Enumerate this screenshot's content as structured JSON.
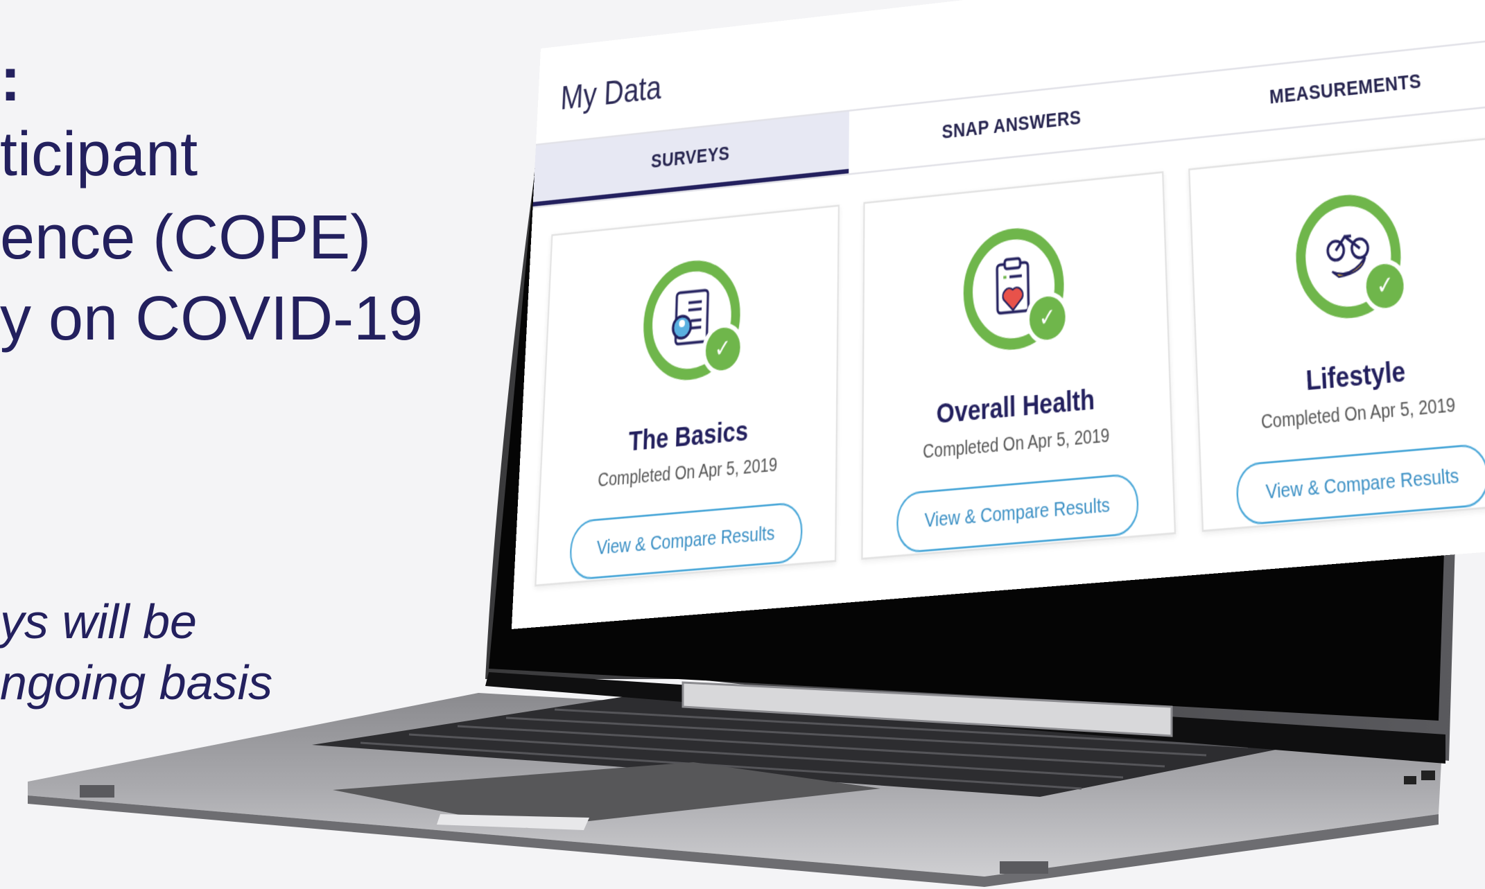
{
  "slide": {
    "lines": [
      ":",
      "ticipant",
      "ence (COPE)",
      "y on COVID-19"
    ],
    "note_lines": [
      "ys will be",
      "ngoing basis"
    ]
  },
  "app": {
    "title": "My Data",
    "tabs": [
      {
        "label": "SURVEYS",
        "active": true
      },
      {
        "label": "SNAP ANSWERS",
        "active": false
      },
      {
        "label": "MEASUREMENTS",
        "active": false
      }
    ],
    "cards": [
      {
        "title": "The Basics",
        "subtitle": "Completed On Apr 5, 2019",
        "button": "View & Compare Results",
        "icon": "document-person-icon"
      },
      {
        "title": "Overall Health",
        "subtitle": "Completed On Apr 5, 2019",
        "button": "View & Compare Results",
        "icon": "clipboard-heart-icon"
      },
      {
        "title": "Lifestyle",
        "subtitle": "Completed On Apr 5, 2019",
        "button": "View & Compare Results",
        "icon": "bicycle-banana-icon"
      }
    ],
    "check_icon": "check-icon"
  },
  "colors": {
    "navy": "#23205e",
    "green": "#6fb64b",
    "button_blue": "#4aa7d8",
    "tab_active_bg": "#e7e8f3"
  }
}
